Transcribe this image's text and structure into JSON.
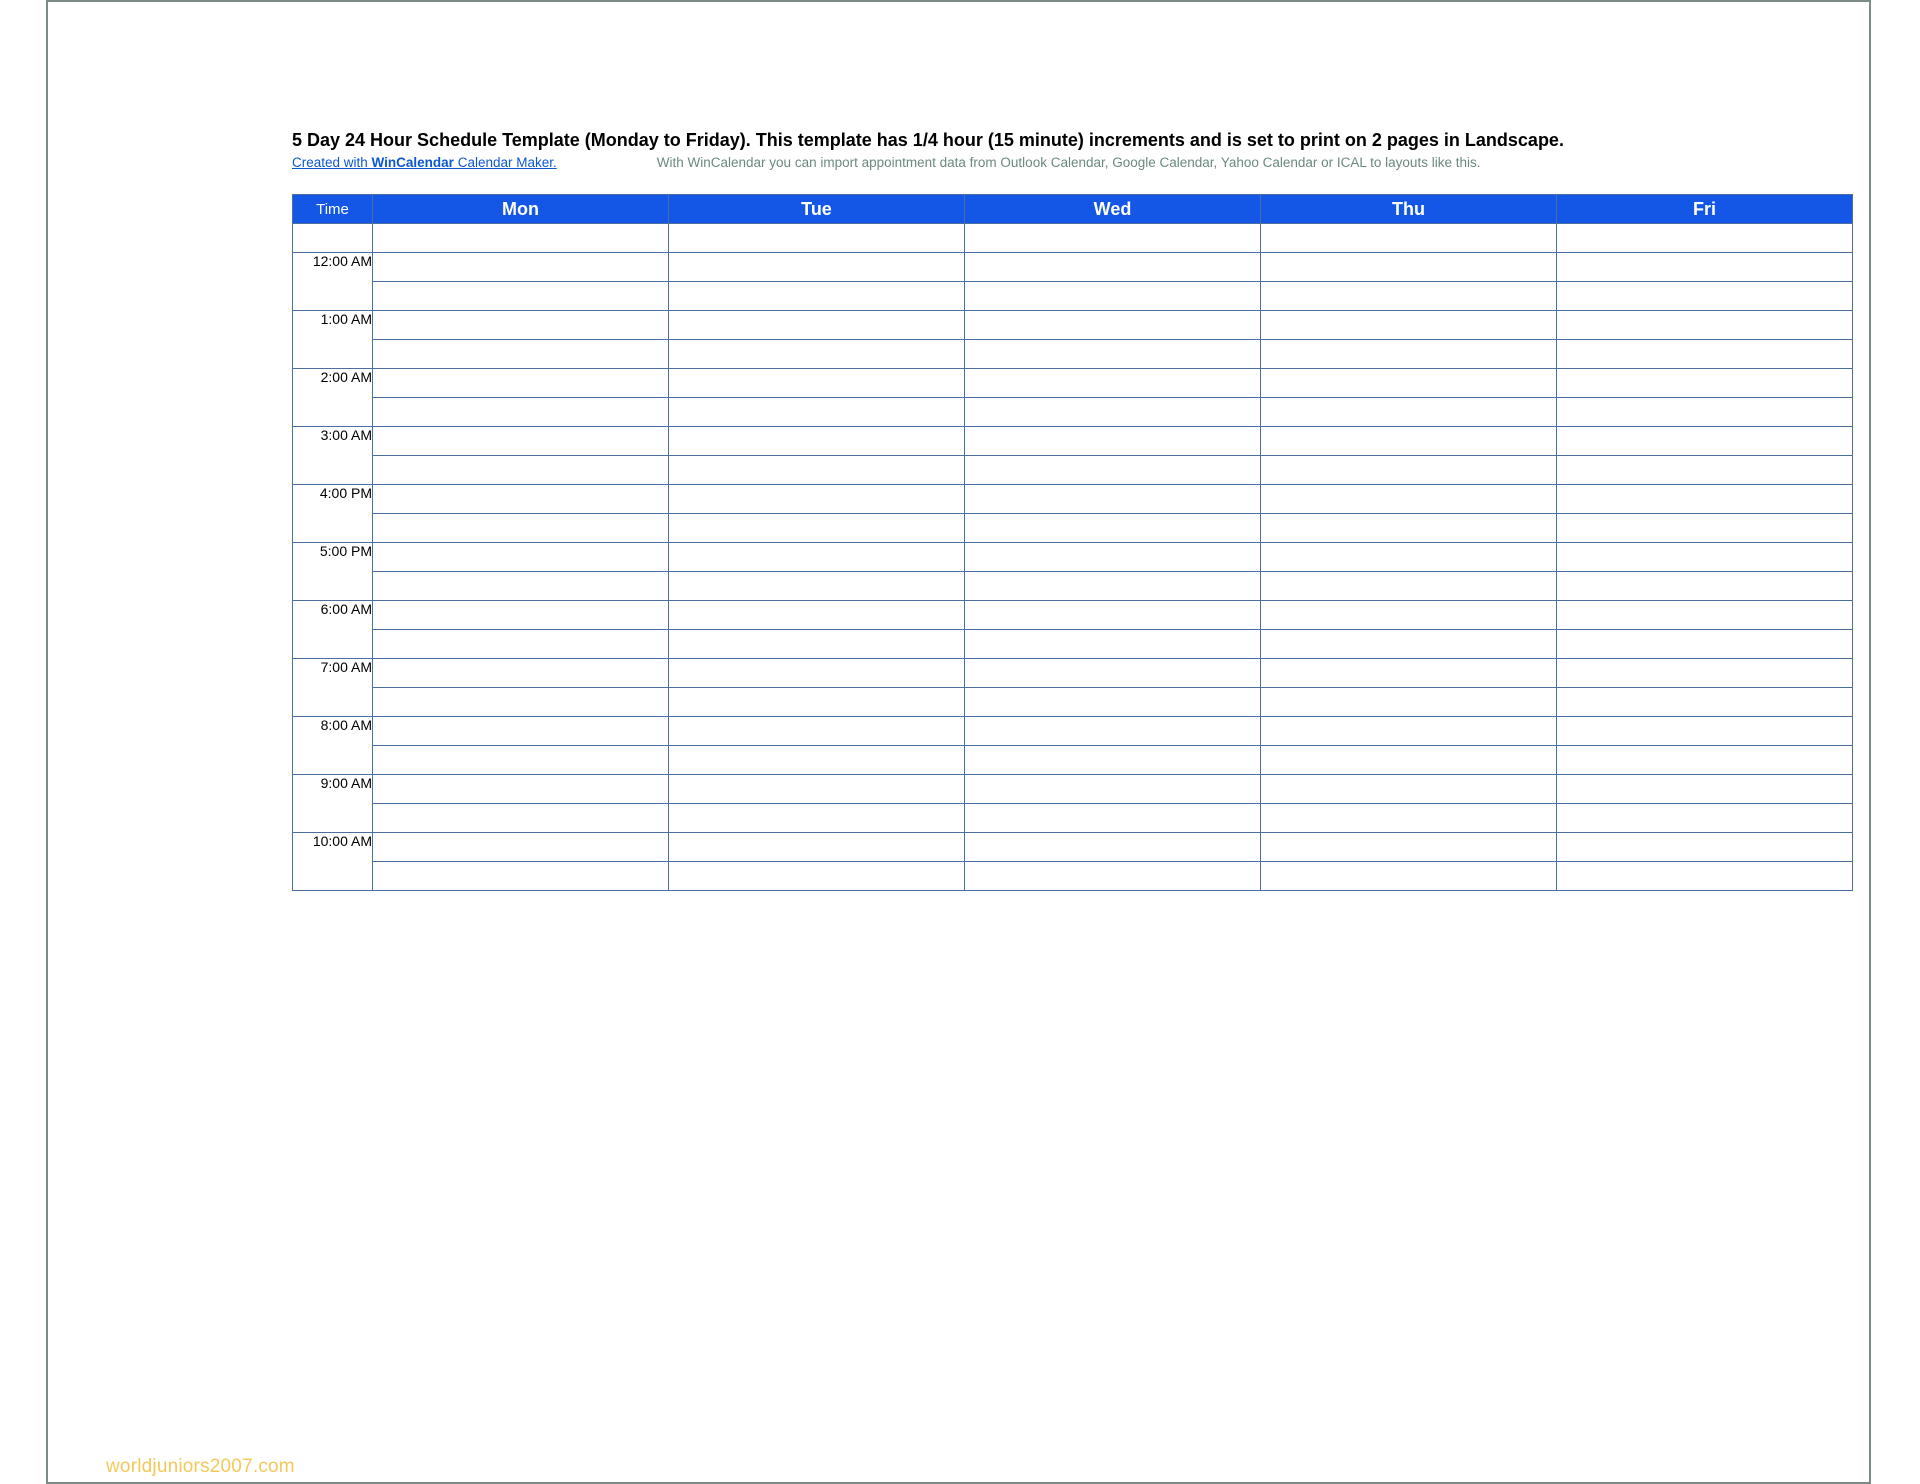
{
  "title": "5 Day 24 Hour Schedule Template (Monday to Friday).  This template has 1/4 hour (15 minute) increments and is set to print on 2 pages in Landscape.",
  "credit_prefix": "Created with ",
  "credit_link": "WinCalendar",
  "credit_suffix": " Calendar Maker.",
  "description": "With WinCalendar you can import appointment data from Outlook Calendar, Google Calendar, Yahoo Calendar or ICAL to layouts like this.",
  "time_header": "Time",
  "days": [
    "Mon",
    "Tue",
    "Wed",
    "Thu",
    "Fri"
  ],
  "times": [
    "12:00 AM",
    "1:00 AM",
    "2:00 AM",
    "3:00 AM",
    "4:00 PM",
    "5:00 PM",
    "6:00 AM",
    "7:00 AM",
    "8:00 AM",
    "9:00 AM",
    "10:00 AM"
  ],
  "watermark": "worldjuniors2007.com"
}
